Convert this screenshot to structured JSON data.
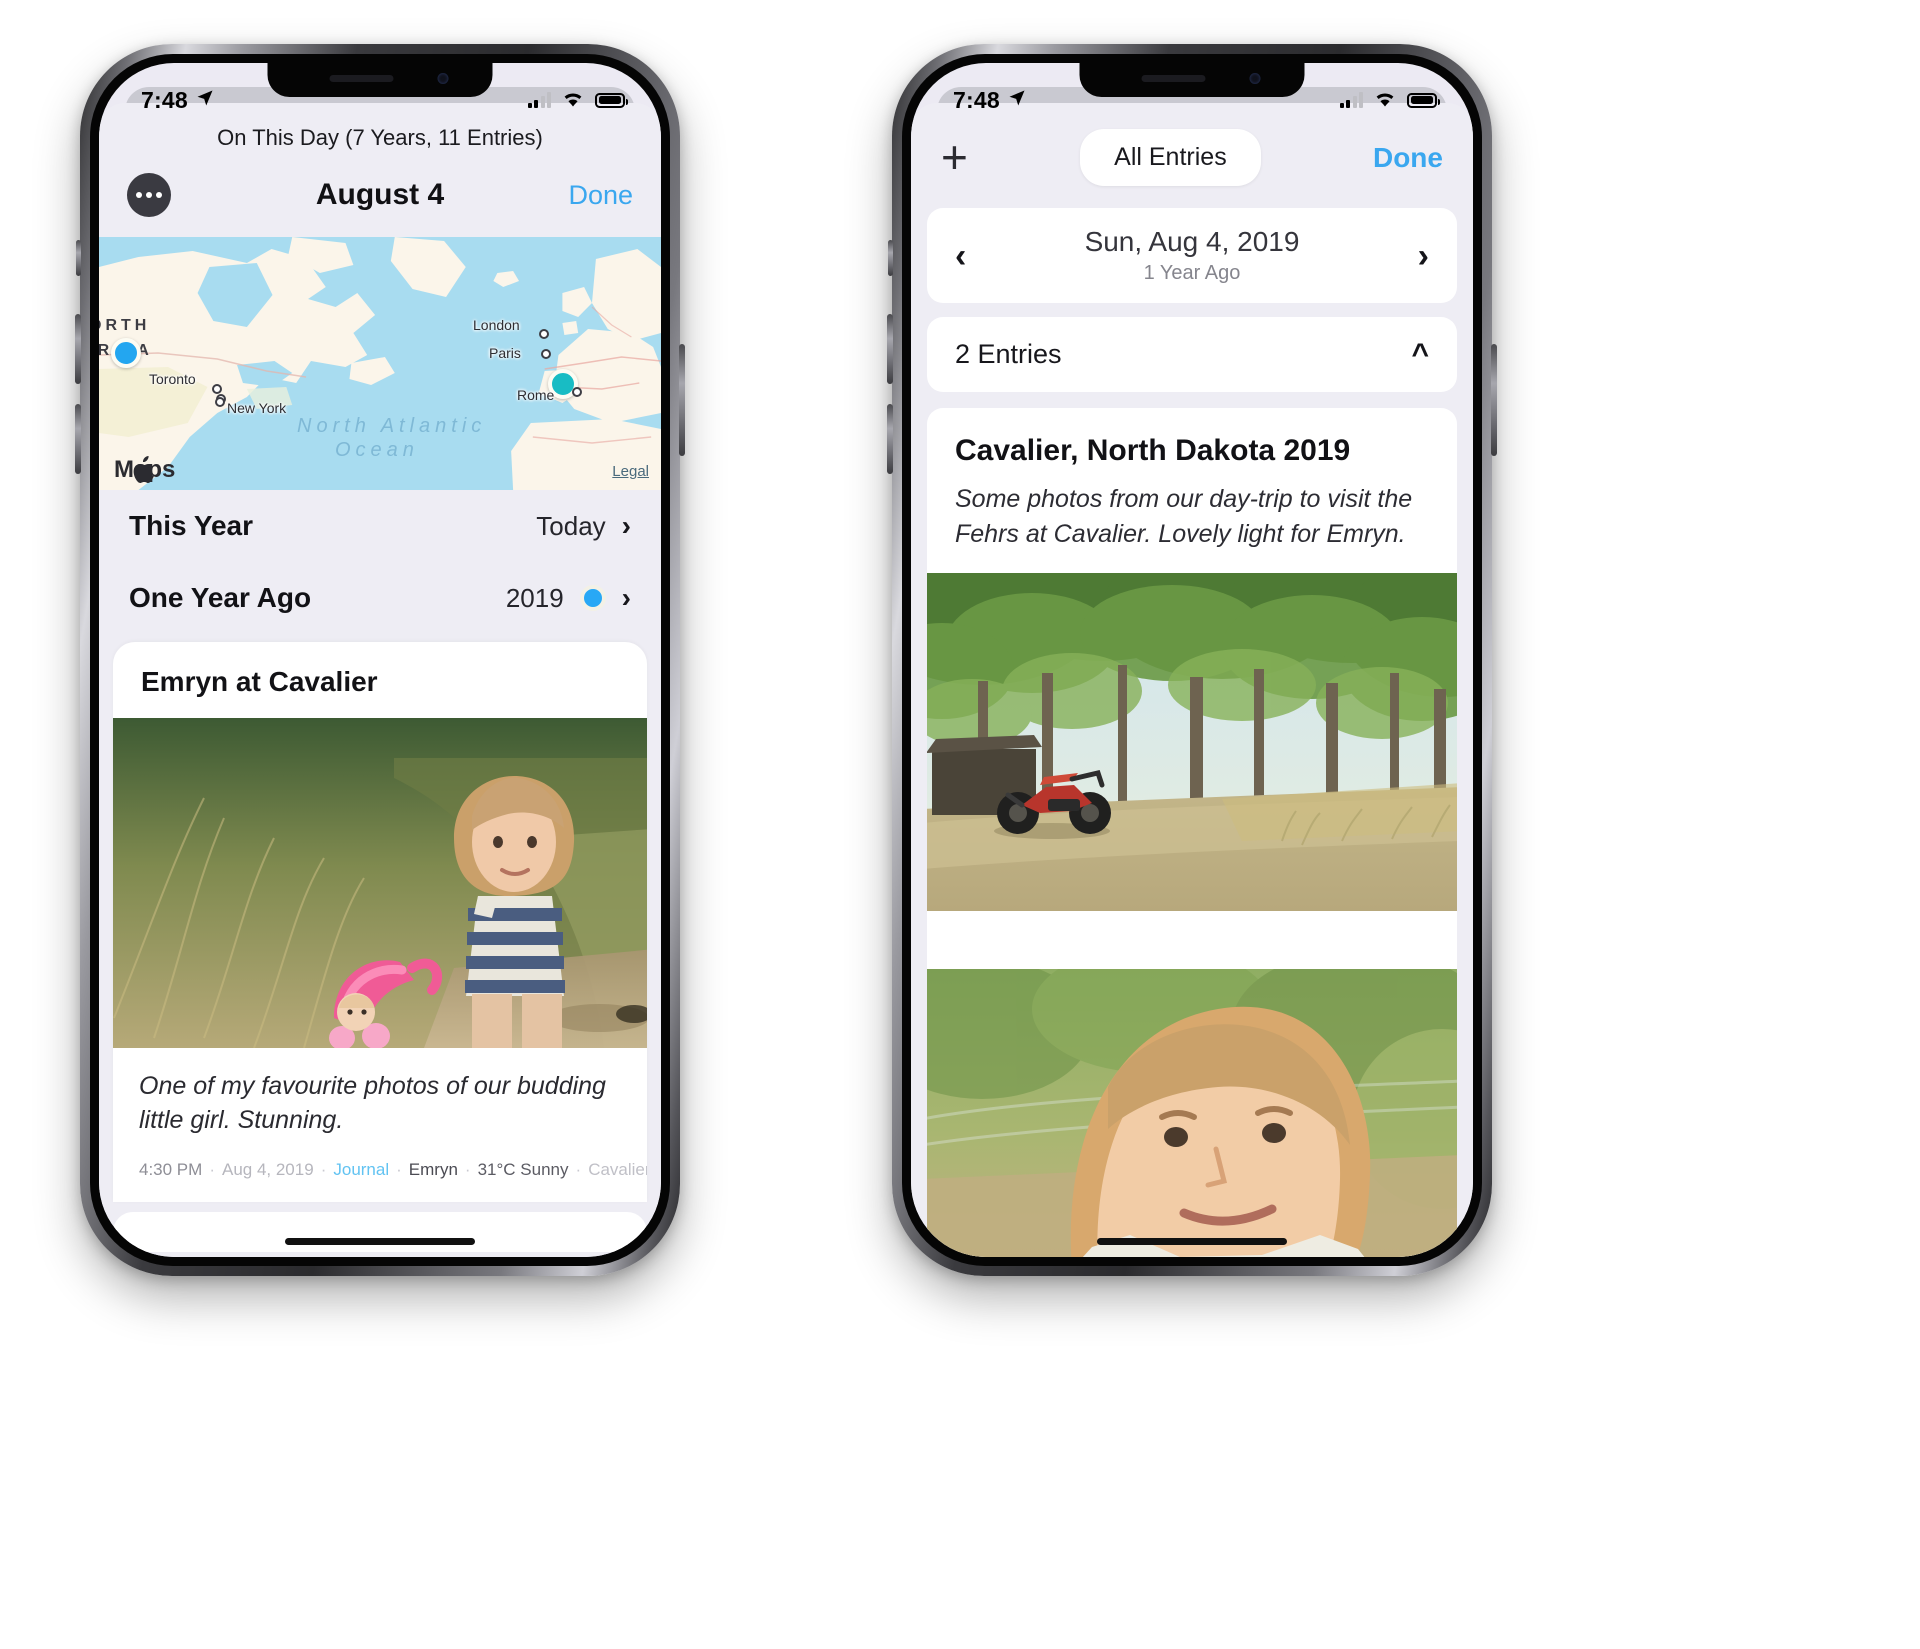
{
  "page": {
    "background": "#ffffff",
    "accent_blue": "#3aa7ef"
  },
  "left_phone": {
    "status_bar": {
      "time": "7:48",
      "location_icon": "location-arrow-icon",
      "wifi_icon": "wifi-icon",
      "cellular_icon": "cellular-bars-icon",
      "battery_icon": "battery-icon"
    },
    "sheet_title": "On This Day (7 Years, 11 Entries)",
    "navbar": {
      "more_icon": "more-dots-icon",
      "title": "August 4",
      "done_label": "Done"
    },
    "map": {
      "labels": [
        {
          "text": "ORTH",
          "type": "continent"
        },
        {
          "text": "ERICA",
          "type": "continent"
        },
        {
          "text": "Toronto",
          "type": "city"
        },
        {
          "text": "New York",
          "type": "city"
        },
        {
          "text": "London",
          "type": "city"
        },
        {
          "text": "Paris",
          "type": "city"
        },
        {
          "text": "Rome",
          "type": "city"
        }
      ],
      "ocean_line_1": "North Atlantic",
      "ocean_line_2": "Ocean",
      "attribution": "Maps",
      "apple_glyph": "",
      "legal_label": "Legal",
      "pins": [
        {
          "name": "pin-north-america",
          "color": "#23a6f0"
        },
        {
          "name": "pin-europe",
          "color": "#18bcc4"
        }
      ]
    },
    "rows": [
      {
        "label": "This Year",
        "value": "Today",
        "has_dot": false,
        "chevron": "chevron-right-icon"
      },
      {
        "label": "One Year Ago",
        "value": "2019",
        "has_dot": true,
        "chevron": "chevron-right-icon"
      }
    ],
    "entry": {
      "title": "Emryn at Cavalier",
      "caption": "One of my favourite photos of our budding little girl. Stunning.",
      "meta": {
        "time": "4:30 PM",
        "date": "Aug 4, 2019",
        "journal": "Journal",
        "person": "Emryn",
        "weather": "31°C Sunny",
        "place": "Cavalier, ND",
        "separator": "·"
      }
    }
  },
  "right_phone": {
    "status_bar": {
      "time": "7:48",
      "location_icon": "location-arrow-icon",
      "wifi_icon": "wifi-icon",
      "cellular_icon": "cellular-bars-icon",
      "battery_icon": "battery-icon"
    },
    "navbar": {
      "add_icon": "plus-icon",
      "filter_label": "All Entries",
      "done_label": "Done"
    },
    "date_nav": {
      "prev_icon": "chevron-left-icon",
      "next_icon": "chevron-right-icon",
      "date": "Sun, Aug 4, 2019",
      "relative": "1 Year Ago"
    },
    "entries_header": {
      "label": "2 Entries",
      "collapse_icon": "chevron-up-icon"
    },
    "entry": {
      "title": "Cavalier, North Dakota 2019",
      "description": "Some photos from our day-trip to visit the Fehrs at Cavalier. Lovely light for Emryn."
    }
  }
}
